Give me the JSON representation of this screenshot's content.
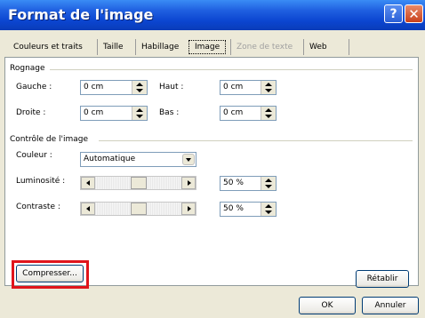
{
  "window": {
    "title": "Format de l'image"
  },
  "tabs": [
    {
      "label": "Couleurs et traits",
      "state": "normal"
    },
    {
      "label": "Taille",
      "state": "normal"
    },
    {
      "label": "Habillage",
      "state": "normal"
    },
    {
      "label": "Image",
      "state": "active"
    },
    {
      "label": "Zone de texte",
      "state": "disabled"
    },
    {
      "label": "Web",
      "state": "normal"
    }
  ],
  "cropping": {
    "title": "Rognage",
    "left_label": "Gauche :",
    "left_value": "0 cm",
    "top_label": "Haut :",
    "top_value": "0 cm",
    "right_label": "Droite :",
    "right_value": "0 cm",
    "bottom_label": "Bas :",
    "bottom_value": "0 cm"
  },
  "image_control": {
    "title": "Contrôle de l'image",
    "color_label": "Couleur :",
    "color_value": "Automatique",
    "brightness_label": "Luminosité :",
    "brightness_value": "50 %",
    "brightness_fraction": 0.5,
    "contrast_label": "Contraste :",
    "contrast_value": "50 %",
    "contrast_fraction": 0.5
  },
  "buttons": {
    "compress": "Compresser...",
    "reset": "Rétablir",
    "ok": "OK",
    "cancel": "Annuler"
  },
  "colors": {
    "titlebar": "#0b45d0",
    "highlight": "#e0141b",
    "dialog_bg": "#ece9d8"
  }
}
